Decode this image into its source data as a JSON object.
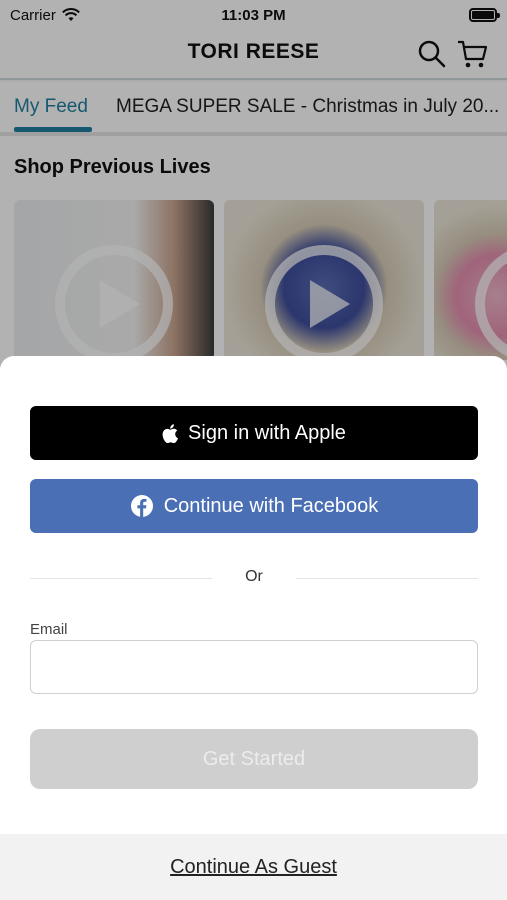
{
  "status_bar": {
    "carrier": "Carrier",
    "time": "11:03 PM"
  },
  "header": {
    "brand": "TORI REESE",
    "icons": [
      "search-icon",
      "cart-icon"
    ]
  },
  "tabs": [
    {
      "label": "My Feed",
      "active": true
    },
    {
      "label": "MEGA SUPER SALE - Christmas in July 20..."
    }
  ],
  "section": {
    "title": "Shop Previous Lives"
  },
  "auth": {
    "apple_label": "Sign in with Apple",
    "facebook_label": "Continue with Facebook",
    "or_label": "Or",
    "email_label": "Email",
    "email_value": "",
    "get_started_label": "Get Started",
    "guest_label": "Continue As Guest"
  },
  "colors": {
    "accent": "#1f7fa0",
    "facebook": "#4a6fb5",
    "apple": "#000000",
    "disabled_button": "#cfcfcf"
  }
}
